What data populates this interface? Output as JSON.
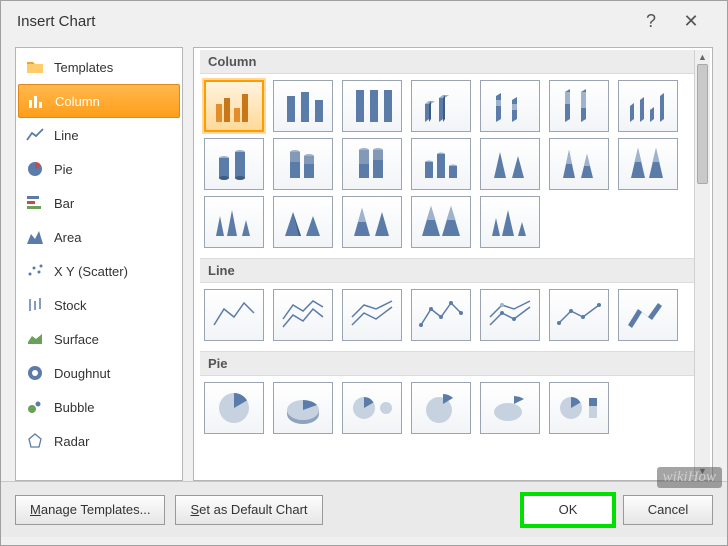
{
  "titlebar": {
    "title": "Insert Chart",
    "help": "?",
    "close": "✕"
  },
  "sidebar": {
    "items": [
      {
        "label": "Templates",
        "icon": "folder-icon",
        "selected": false
      },
      {
        "label": "Column",
        "icon": "column-icon",
        "selected": true
      },
      {
        "label": "Line",
        "icon": "line-icon",
        "selected": false
      },
      {
        "label": "Pie",
        "icon": "pie-icon",
        "selected": false
      },
      {
        "label": "Bar",
        "icon": "bar-icon",
        "selected": false
      },
      {
        "label": "Area",
        "icon": "area-icon",
        "selected": false
      },
      {
        "label": "X Y (Scatter)",
        "icon": "scatter-icon",
        "selected": false
      },
      {
        "label": "Stock",
        "icon": "stock-icon",
        "selected": false
      },
      {
        "label": "Surface",
        "icon": "surface-icon",
        "selected": false
      },
      {
        "label": "Doughnut",
        "icon": "doughnut-icon",
        "selected": false
      },
      {
        "label": "Bubble",
        "icon": "bubble-icon",
        "selected": false
      },
      {
        "label": "Radar",
        "icon": "radar-icon",
        "selected": false
      }
    ]
  },
  "gallery": {
    "sections": [
      {
        "title": "Column",
        "count": 19,
        "selected_index": 0
      },
      {
        "title": "Line",
        "count": 7
      },
      {
        "title": "Pie",
        "count": 6
      }
    ]
  },
  "footer": {
    "manage_templates": "Manage Templates...",
    "set_default": "Set as Default Chart",
    "ok": "OK",
    "cancel": "Cancel"
  },
  "watermark": "wikiHow"
}
